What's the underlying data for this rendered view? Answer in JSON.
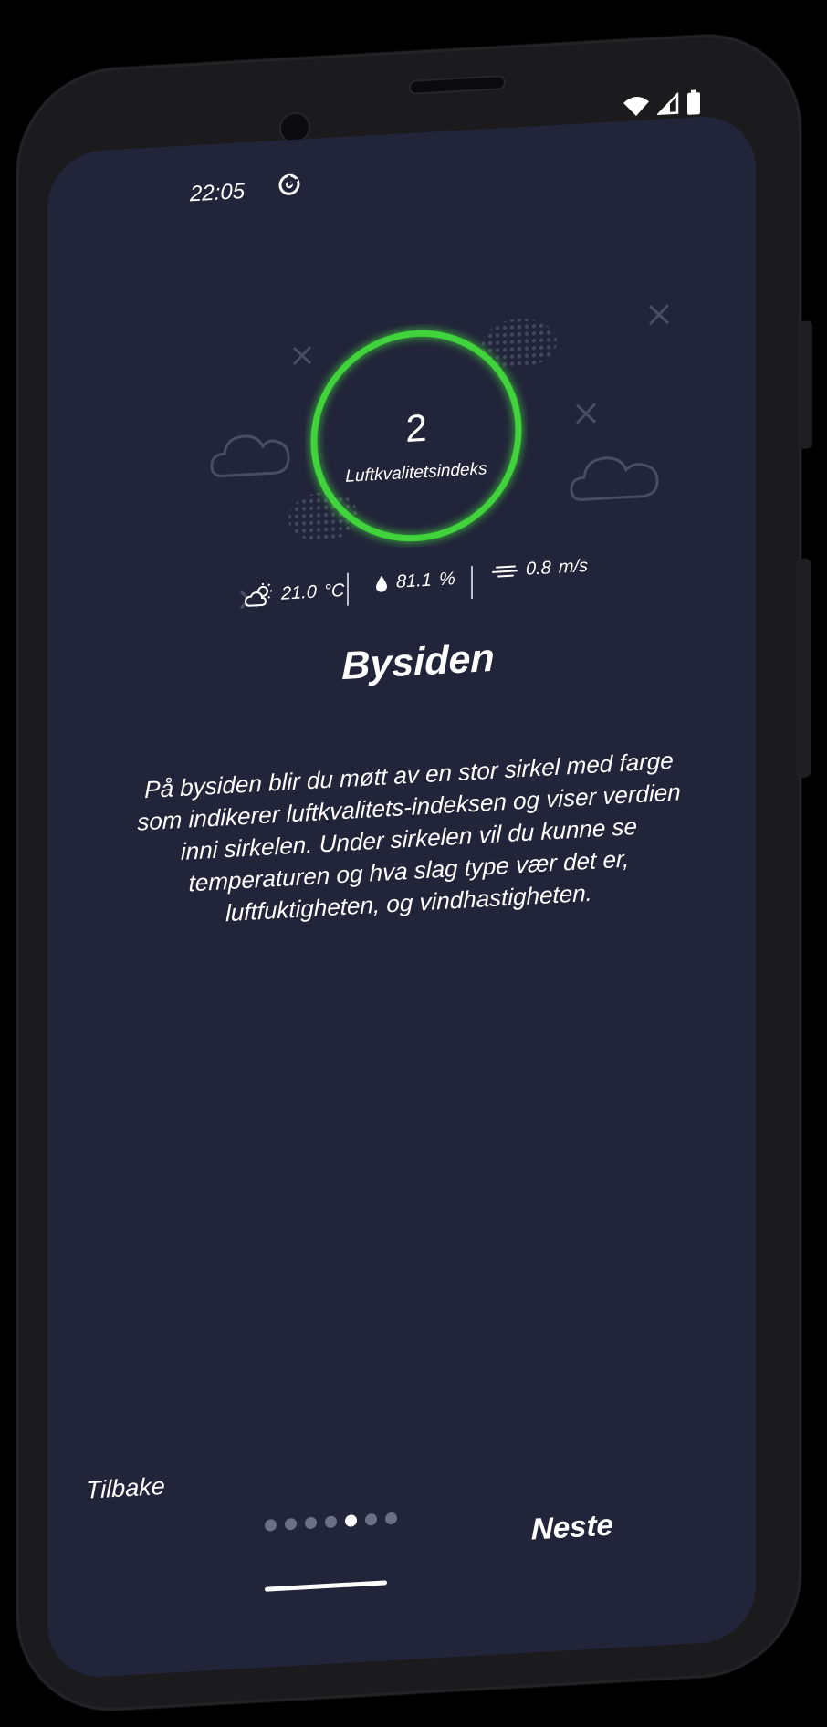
{
  "status_bar": {
    "time": "22:05",
    "notification_icon": "target-icon",
    "icons": [
      "wifi-icon",
      "signal-icon",
      "battery-icon"
    ]
  },
  "aqi": {
    "value": "2",
    "label": "Luftkvalitetsindeks",
    "ring_color": "#3fd33a"
  },
  "weather": {
    "temperature_icon": "partly-cloudy-icon",
    "temperature": "21.0",
    "temperature_unit": "°C",
    "humidity_icon": "droplet-icon",
    "humidity": "81.1",
    "humidity_unit": "%",
    "wind_icon": "wind-icon",
    "wind": "0.8",
    "wind_unit": "m/s"
  },
  "content": {
    "title": "Bysiden",
    "description": "På bysiden blir du møtt av en stor sirkel med farge som indikerer luftkvalitets-indeksen og viser verdien inni sirkelen. Under sirkelen vil du kunne se temperaturen og hva slag type vær det er, luftfuktigheten, og vindhastigheten."
  },
  "navigation": {
    "back_label": "Tilbake",
    "next_label": "Neste",
    "page_count": 7,
    "current_page": 5
  },
  "colors": {
    "background": "#22243a",
    "accent": "#3fd33a",
    "text": "#ffffff"
  }
}
